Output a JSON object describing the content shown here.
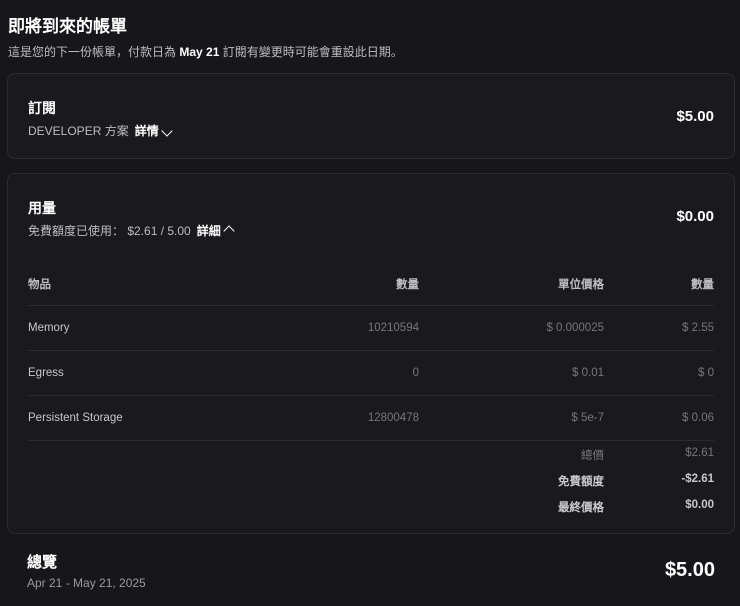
{
  "header": {
    "title": "即將到來的帳單",
    "subtitle_pre": "這是您的下一份帳單，付款日為",
    "date": "May 21",
    "subtitle_post": "訂閱有變更時可能會重設此日期。"
  },
  "subscription": {
    "title": "訂閱",
    "plan": "DEVELOPER 方案",
    "details": "詳情",
    "amount": "$5.00"
  },
  "usage": {
    "title": "用量",
    "quota": "免費額度已使用： $2.61 / 5.00",
    "details": "詳細",
    "amount": "$0.00",
    "columns": [
      "物品",
      "數量",
      "單位價格",
      "數量"
    ],
    "rows": [
      [
        "Memory",
        "10210594",
        "$ 0.000025",
        "$ 2.55"
      ],
      [
        "Egress",
        "0",
        "$ 0.01",
        "$ 0"
      ],
      [
        "Persistent Storage",
        "12800478",
        "$ 5e-7",
        "$ 0.06"
      ]
    ],
    "totals": [
      {
        "label": "總價",
        "value": "$2.61"
      },
      {
        "label": "免費額度",
        "value": "-$2.61"
      },
      {
        "label": "最終價格",
        "value": "$0.00"
      }
    ]
  },
  "overview": {
    "title": "總覽",
    "period": "Apr 21 - May 21, 2025",
    "amount": "$5.00"
  }
}
